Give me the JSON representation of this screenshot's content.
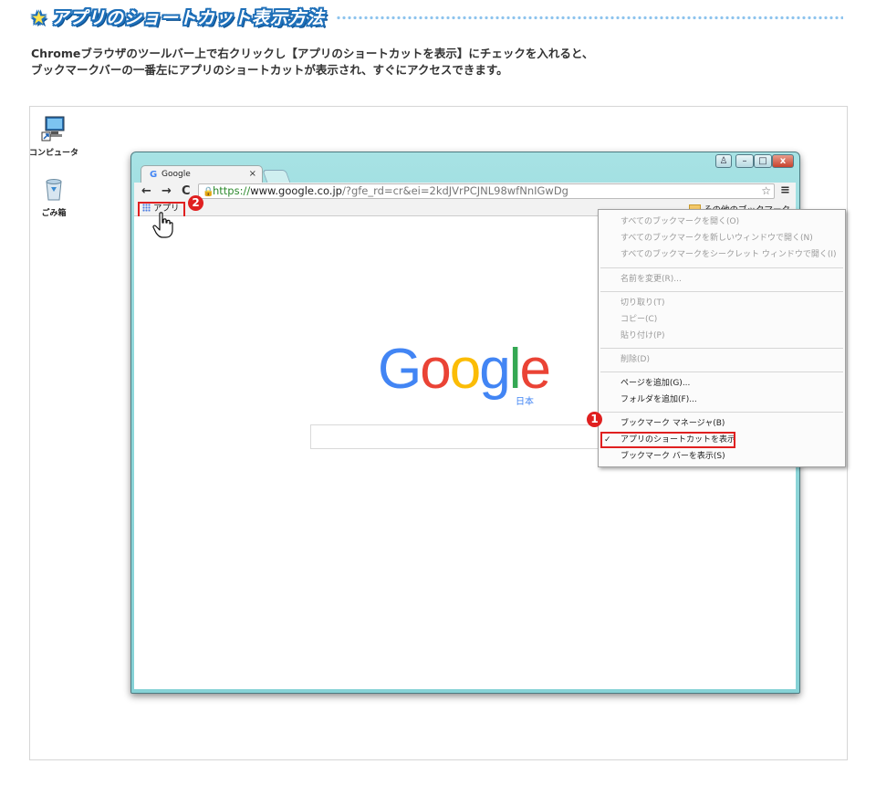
{
  "heading": {
    "star": "★",
    "title": "アプリのショートカット表示方法"
  },
  "intro": {
    "line1": "Chromeブラウザのツールバー上で右クリックし【アプリのショートカットを表示】にチェックを入れると、",
    "line2": "ブックマークバーの一番左にアプリのショートカットが表示され、すぐにアクセスできます。"
  },
  "desktop": {
    "icons": [
      {
        "label": "コンピュータ",
        "icon": "computer-icon"
      },
      {
        "label": "ごみ箱",
        "icon": "recycle-bin-icon"
      }
    ]
  },
  "browser": {
    "tab_favicon": "G",
    "tab_title": "Google",
    "tab_close": "×",
    "nav": {
      "back": "←",
      "forward": "→",
      "reload": "C"
    },
    "url": {
      "scheme": "https://",
      "domain": "www.google.co.jp",
      "rest": "/?gfe_rd=cr&ei=2kdJVrPCJNL98wfNnIGwDg"
    },
    "bookmark_star": "☆",
    "menu_glyph": "≡",
    "apps_label": "アプリ",
    "other_bookmarks": "その他のブックマーク",
    "page": {
      "logo": [
        "G",
        "o",
        "o",
        "g",
        "l",
        "e"
      ],
      "logo_sub": "日本"
    }
  },
  "context_menu": {
    "items": [
      {
        "label": "すべてのブックマークを開く(O)",
        "enabled": false
      },
      {
        "label": "すべてのブックマークを新しいウィンドウで開く(N)",
        "enabled": false
      },
      {
        "label": "すべてのブックマークをシークレット ウィンドウで開く(I)",
        "enabled": false
      },
      {
        "label": "名前を変更(R)...",
        "enabled": false
      },
      {
        "label": "切り取り(T)",
        "enabled": false
      },
      {
        "label": "コピー(C)",
        "enabled": false
      },
      {
        "label": "貼り付け(P)",
        "enabled": false
      },
      {
        "label": "削除(D)",
        "enabled": false
      },
      {
        "label": "ページを追加(G)...",
        "enabled": true
      },
      {
        "label": "フォルダを追加(F)...",
        "enabled": true
      },
      {
        "label": "ブックマーク マネージャ(B)",
        "enabled": true
      },
      {
        "label": "アプリのショートカットを表示",
        "enabled": true,
        "checked": true
      },
      {
        "label": "ブックマーク バーを表示(S)",
        "enabled": true
      }
    ],
    "check_glyph": "✓"
  },
  "callouts": {
    "one": "1",
    "two": "2"
  },
  "colors": {
    "callout_red": "#e02020",
    "window_frame": "#8fd7da",
    "heading_blue": "#1e6fb8"
  }
}
